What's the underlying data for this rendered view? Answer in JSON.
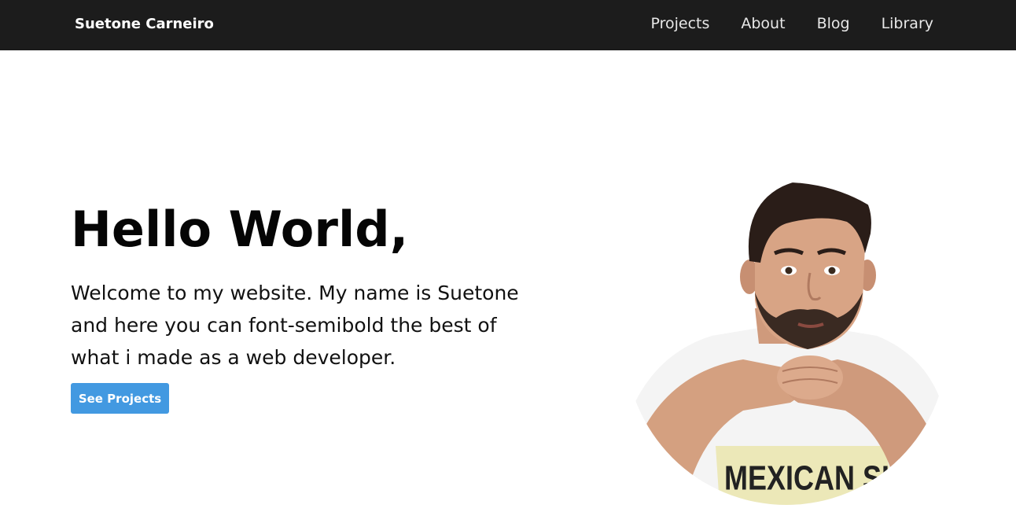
{
  "navbar": {
    "brand": "Suetone Carneiro",
    "links": [
      {
        "label": "Projects"
      },
      {
        "label": "About"
      },
      {
        "label": "Blog"
      },
      {
        "label": "Library"
      }
    ]
  },
  "hero": {
    "title": "Hello World,",
    "text": "Welcome to my website. My name is Suetone and here you can font-semibold the best of what i made as a web developer.",
    "button_label": "See Projects",
    "portrait_shirt_text": "MEXICAN SKULL"
  },
  "colors": {
    "navbar_bg": "#1c1c1c",
    "button_bg": "#4299e1",
    "page_bg": "#ffffff"
  }
}
